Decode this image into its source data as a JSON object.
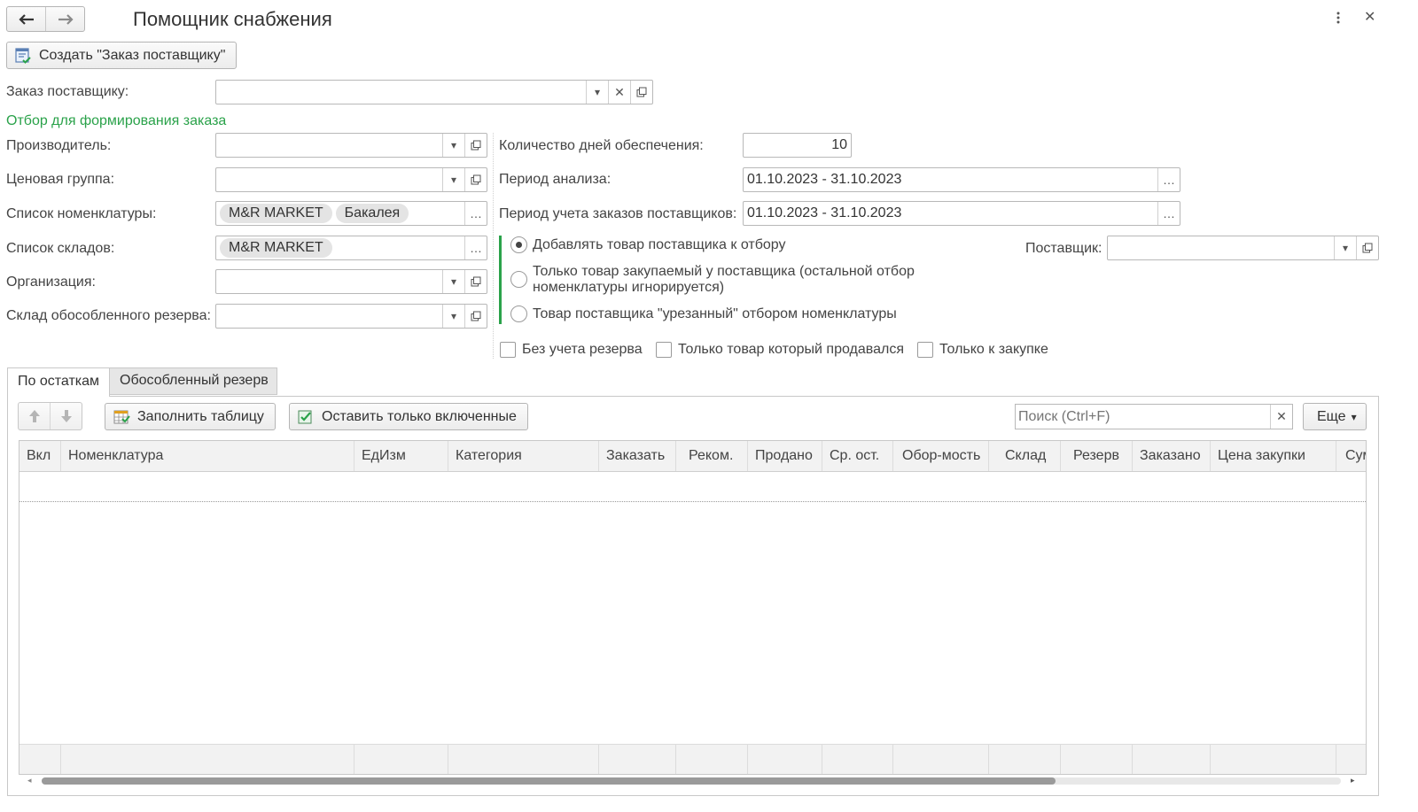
{
  "header": {
    "title": "Помощник снабжения",
    "back_icon": "arrow-left-icon",
    "forward_icon": "arrow-right-icon"
  },
  "toolbar": {
    "create_order_label": "Создать \"Заказ поставщику\""
  },
  "form": {
    "supplier_order_label": "Заказ поставщику:",
    "supplier_order_value": "",
    "filter_section_title": "Отбор для формирования заказа",
    "manufacturer_label": "Производитель:",
    "manufacturer_value": "",
    "price_group_label": "Ценовая группа:",
    "price_group_value": "",
    "nomenclature_list_label": "Список номенклатуры:",
    "nomenclature_tags": [
      "M&R MARKET",
      "Бакалея"
    ],
    "warehouse_list_label": "Список складов:",
    "warehouse_tags": [
      "M&R MARKET"
    ],
    "organization_label": "Организация:",
    "organization_value": "",
    "reserve_warehouse_label": "Склад обособленного резерва:",
    "reserve_warehouse_value": "",
    "supply_days_label": "Количество дней обеспечения:",
    "supply_days_value": "10",
    "analysis_period_label": "Период анализа:",
    "analysis_period_value": "01.10.2023 - 31.10.2023",
    "orders_period_label": "Период учета заказов поставщиков:",
    "orders_period_value": "01.10.2023 - 31.10.2023",
    "radio_add_label": "Добавлять товар поставщика к отбору",
    "radio_only_line1": "Только товар закупаемый у поставщика (остальной отбор",
    "radio_only_line2": "номенклатуры игнорируется)",
    "radio_cut_label": "Товар поставщика \"урезанный\" отбором номенклатуры",
    "supplier_label": "Поставщик:",
    "supplier_value": "",
    "chk_no_reserve_label": "Без учета резерва",
    "chk_sold_only_label": "Только товар который продавался",
    "chk_purchase_only_label": "Только к закупке"
  },
  "tabs": {
    "remains": "По остаткам",
    "reserve": "Обособленный резерв"
  },
  "table_toolbar": {
    "fill_label": "Заполнить таблицу",
    "keep_included_label": "Оставить только включенные",
    "search_placeholder": "Поиск (Ctrl+F)",
    "more_label": "Еще"
  },
  "table": {
    "columns": [
      "Вкл",
      "Номенклатура",
      "ЕдИзм",
      "Категория",
      "Заказать",
      "Реком.",
      "Продано",
      "Ср. ост.",
      "Обор-мость",
      "Склад",
      "Резерв",
      "Заказано",
      "Цена закупки",
      "Сум"
    ]
  },
  "colors": {
    "accent_green": "#2aa24a",
    "border": "#b8b8b8"
  }
}
